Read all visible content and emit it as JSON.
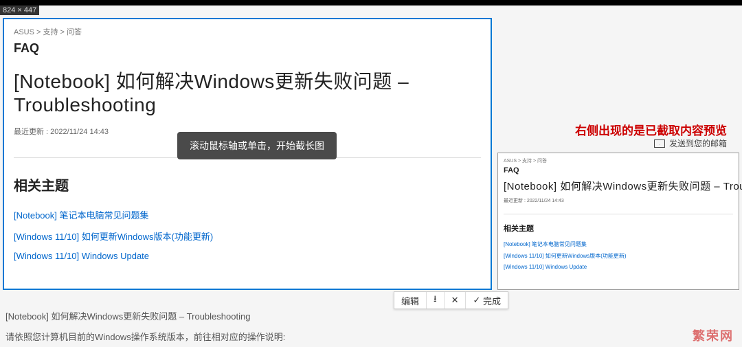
{
  "dimensions_label": "824 × 447",
  "breadcrumb": "ASUS  >  支持  >  问答",
  "faq_label": "FAQ",
  "page_title": "[Notebook] 如何解决Windows更新失败问题 – Troubleshooting",
  "last_updated": "最近更新 : 2022/11/24 14:43",
  "tooltip": "滚动鼠标轴或单击，开始截长图",
  "related_heading": "相关主题",
  "related_links": [
    "[Notebook] 笔记本电脑常见问题集",
    "[Windows 11/10] 如何更新Windows版本(功能更新)",
    "[Windows 11/10] Windows Update"
  ],
  "red_note": "右侧出现的是已截取内容预览",
  "email_label": "发送到您的邮箱",
  "toolbar": {
    "edit": "编辑",
    "download_icon": "⭳",
    "cancel_icon": "✕",
    "done_icon": "✓",
    "done_label": "完成"
  },
  "below_text_1": "[Notebook] 如何解决Windows更新失败问题 – Troubleshooting",
  "below_text_2": "请依照您计算机目前的Windows操作系统版本，前往相对应的操作说明:",
  "watermark": "繁荣网"
}
